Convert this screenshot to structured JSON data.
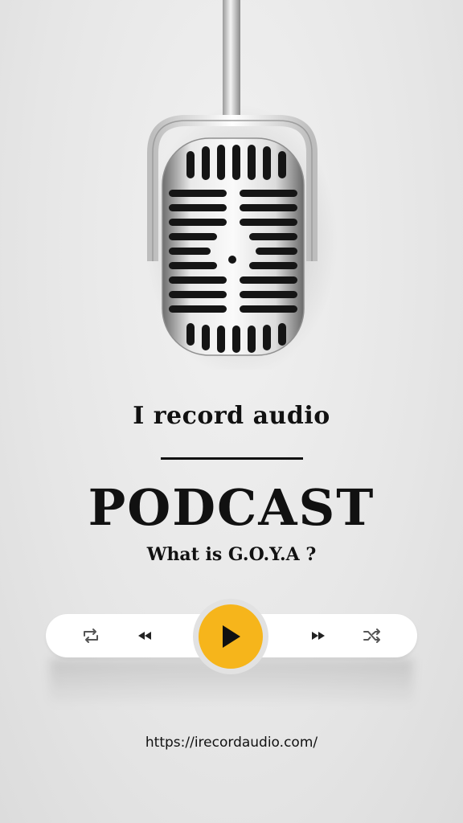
{
  "header": {
    "subtitle": "I record audio"
  },
  "main": {
    "title": "PODCAST",
    "episode": "What is G.O.Y.A ?"
  },
  "player": {
    "controls": [
      {
        "name": "repeat",
        "icon": "repeat-icon"
      },
      {
        "name": "rewind",
        "icon": "rewind-icon"
      },
      {
        "name": "play",
        "icon": "play-icon"
      },
      {
        "name": "fast-forward",
        "icon": "fast-forward-icon"
      },
      {
        "name": "shuffle",
        "icon": "shuffle-icon"
      }
    ],
    "accent_color": "#f6b51b"
  },
  "footer": {
    "url": "https://irecordaudio.com/"
  },
  "image": {
    "subject": "microphone-icon"
  }
}
